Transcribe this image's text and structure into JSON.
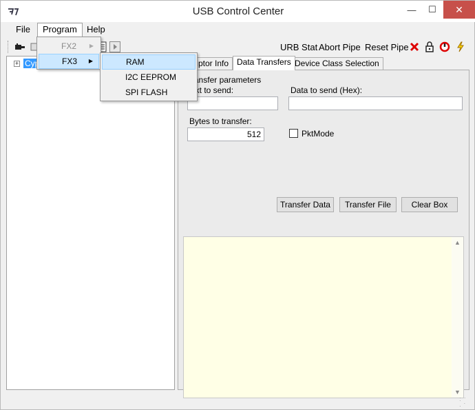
{
  "window": {
    "title": "USB Control Center",
    "minimize_glyph": "—",
    "maximize_glyph": "☐",
    "close_glyph": "✕"
  },
  "menubar": {
    "file": "File",
    "program": "Program",
    "help": "Help"
  },
  "program_menu": {
    "items": [
      {
        "label": "FX2",
        "enabled": false,
        "has_submenu": true
      },
      {
        "label": "FX3",
        "enabled": true,
        "has_submenu": true,
        "highlighted": true
      }
    ],
    "arrow_glyph": "▶"
  },
  "fx3_submenu": {
    "items": [
      {
        "label": "RAM",
        "highlighted": true
      },
      {
        "label": "I2C EEPROM"
      },
      {
        "label": "SPI FLASH"
      }
    ]
  },
  "toolbar": {
    "urb_stat": "URB Stat",
    "abort_pipe": "Abort Pipe",
    "reset_pipe": "Reset Pipe",
    "icons": [
      "plug-icon",
      "device-icon",
      "script-icon",
      "play-icon",
      "stop-icon",
      "lock-icon",
      "power-icon",
      "lightning-icon"
    ]
  },
  "tree": {
    "expander_glyph": "+",
    "node_label": "Cyp"
  },
  "tabs": {
    "descriptor_info": "Descriptor Info",
    "data_transfers": "Data Transfers",
    "device_class_selection": "Device Class Selection",
    "active": "Data Transfers"
  },
  "transfer": {
    "group_title": "Transfer parameters",
    "text_to_send_label": "Text to send:",
    "text_to_send_value": "",
    "hex_to_send_label": "Data to send (Hex):",
    "hex_to_send_value": "",
    "bytes_label": "Bytes to transfer:",
    "bytes_value": "512",
    "pktmode_label": "PktMode",
    "pktmode_checked": false,
    "transfer_data_btn": "Transfer Data",
    "transfer_file_btn": "Transfer File",
    "clear_box_btn": "Clear Box"
  },
  "output": {
    "text": "",
    "background": "#ffffe6"
  },
  "colors": {
    "close_button": "#c7504a",
    "selection": "#3399ff",
    "menu_highlight": "#cce8ff"
  }
}
